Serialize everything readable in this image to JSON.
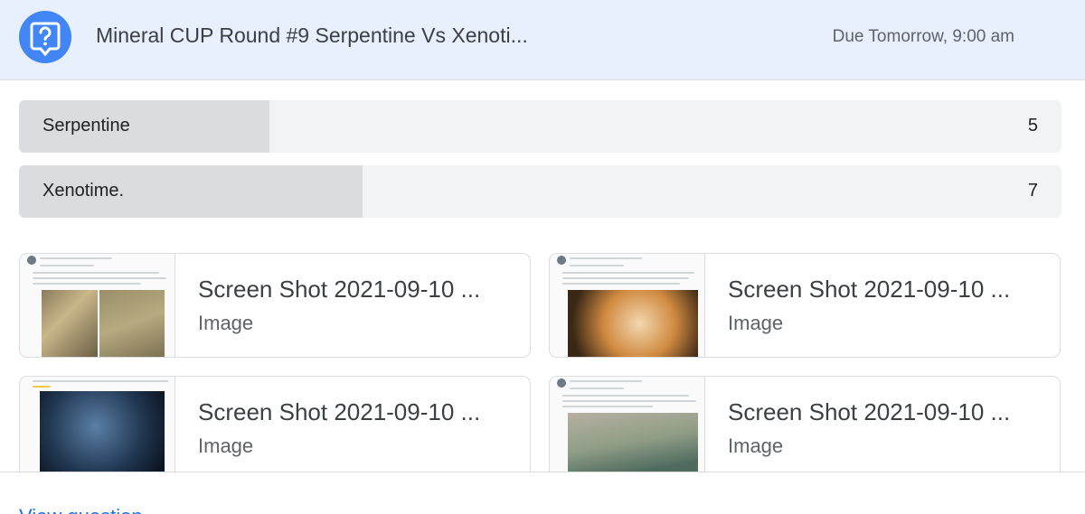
{
  "header": {
    "icon": "question-icon",
    "title": "Mineral CUP Round #9 Serpentine Vs Xenoti...",
    "due": "Due Tomorrow, 9:00 am"
  },
  "poll": {
    "options": [
      {
        "label": "Serpentine",
        "count": "5"
      },
      {
        "label": "Xenotime.",
        "count": "7"
      }
    ],
    "fill_fraction": [
      0.24,
      0.33
    ]
  },
  "attachments": [
    {
      "name": "Screen Shot 2021-09-10 ...",
      "type": "Image"
    },
    {
      "name": "Screen Shot 2021-09-10 ...",
      "type": "Image"
    },
    {
      "name": "Screen Shot 2021-09-10 ...",
      "type": "Image"
    },
    {
      "name": "Screen Shot 2021-09-10 ...",
      "type": "Image"
    }
  ],
  "footer": {
    "link": "View question"
  },
  "colors": {
    "header_bg": "#e8f0fe",
    "accent": "#4285f4",
    "poll_fill": "#dadce0",
    "poll_bg": "#f1f3f4",
    "link": "#1a73e8"
  }
}
